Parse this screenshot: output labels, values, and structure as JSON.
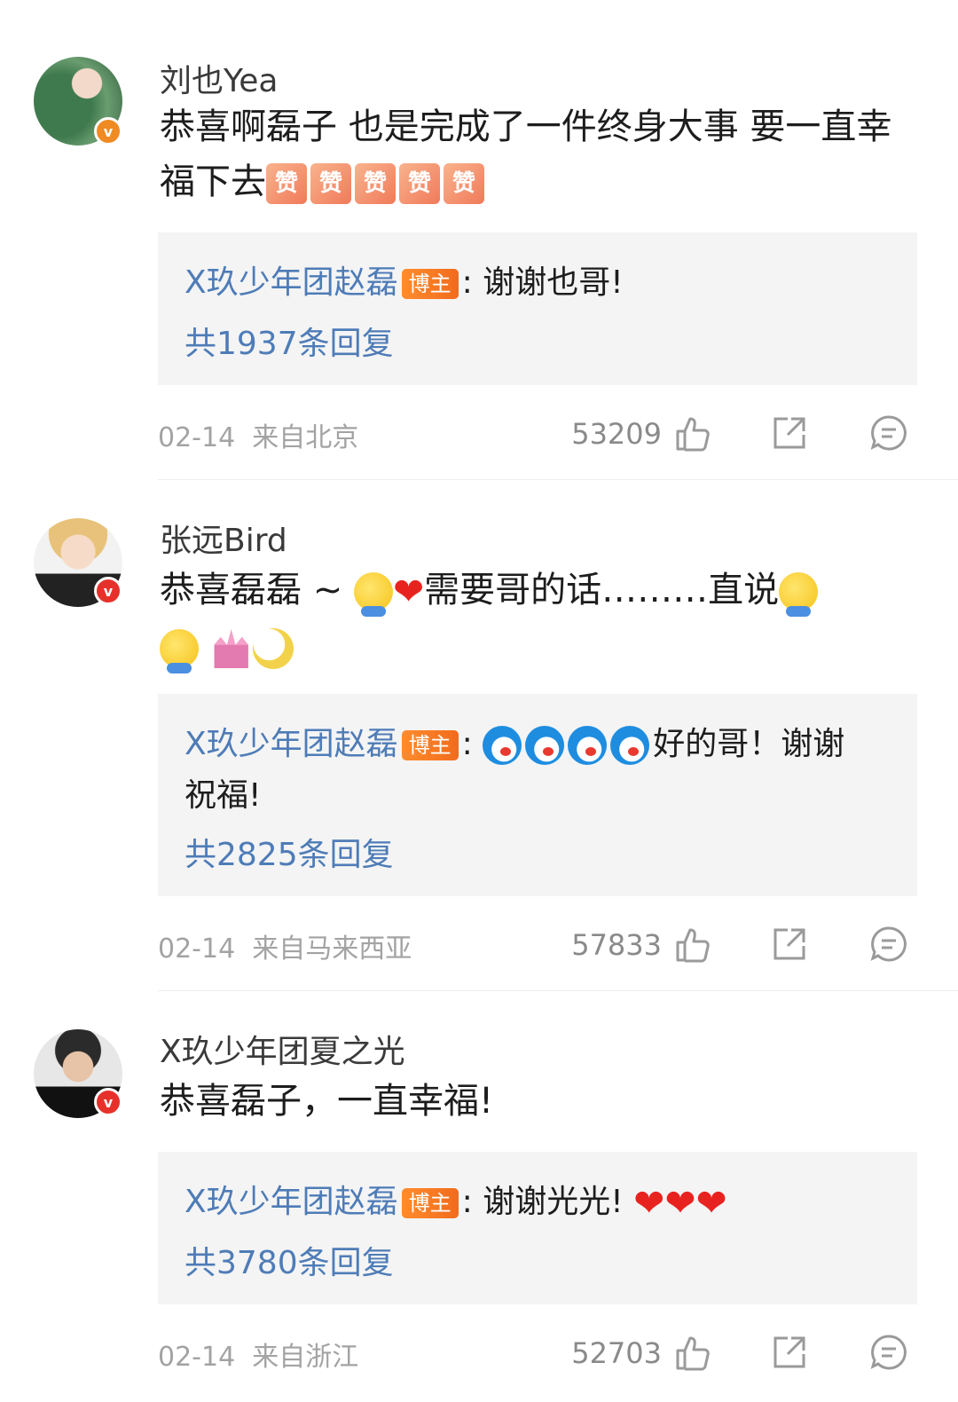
{
  "comments": [
    {
      "username": "刘也Yea",
      "text": "恭喜啊磊子 也是完成了一件终身大事 要一直幸福下去",
      "zan_glyph": "赞",
      "reply": {
        "author": "X玖少年团赵磊",
        "tag": "博主",
        "text": ": 谢谢也哥!",
        "count": "共1937条回复"
      },
      "date": "02-14",
      "location": "来自北京",
      "likes": "53209"
    },
    {
      "username": "张远Bird",
      "text_a": "恭喜磊磊 ~",
      "text_b": "需要哥的话………直说",
      "reply": {
        "author": "X玖少年团赵磊",
        "tag": "博主",
        "text": "好的哥！谢谢",
        "text2": "祝福!",
        "count": "共2825条回复"
      },
      "date": "02-14",
      "location": "来自马来西亚",
      "likes": "57833"
    },
    {
      "username": "X玖少年团夏之光",
      "text": "恭喜磊子，一直幸福!",
      "reply": {
        "author": "X玖少年团赵磊",
        "tag": "博主",
        "text": ": 谢谢光光!",
        "count": "共3780条回复"
      },
      "date": "02-14",
      "location": "来自浙江",
      "likes": "52703"
    }
  ],
  "icons": [
    "like-icon",
    "share-icon",
    "comment-icon",
    "verified-badge-icon"
  ],
  "colors": {
    "link_blue": "#4e7cb7",
    "host_tag": "#f16b1c",
    "heart": "#e8231f"
  }
}
